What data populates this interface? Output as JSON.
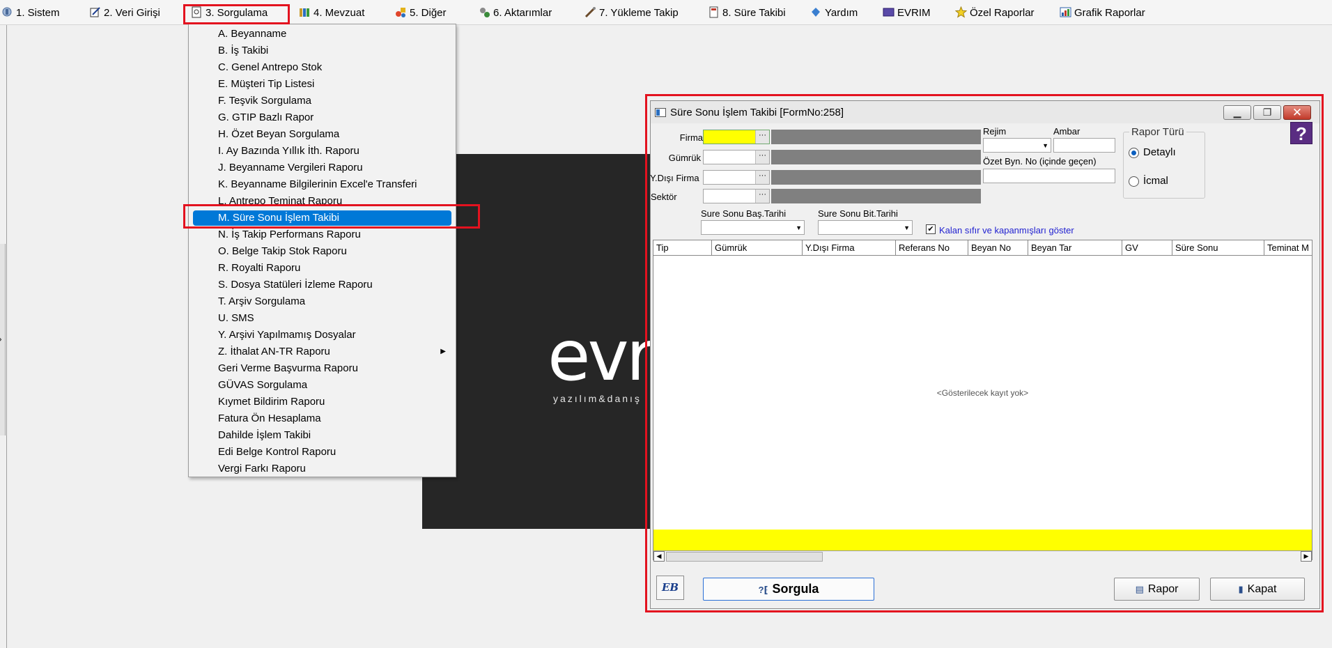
{
  "menubar": {
    "items": [
      {
        "label": "1.  Sistem",
        "icon": "wrench-icon"
      },
      {
        "label": "2.  Veri Girişi",
        "icon": "edit-icon"
      },
      {
        "label": "3.  Sorgulama",
        "icon": "report-icon"
      },
      {
        "label": "4.  Mevzuat",
        "icon": "books-icon"
      },
      {
        "label": "5.  Diğer",
        "icon": "shapes-icon"
      },
      {
        "label": "6.  Aktarımlar",
        "icon": "gears-icon"
      },
      {
        "label": "7.  Yükleme Takip",
        "icon": "tools-icon"
      },
      {
        "label": "8. Süre Takibi",
        "icon": "hourglass-icon"
      },
      {
        "label": "Yardım",
        "icon": "help-icon"
      },
      {
        "label": "EVRIM",
        "icon": "book-icon"
      },
      {
        "label": "Özel Raporlar",
        "icon": "star-icon"
      },
      {
        "label": "Grafik Raporlar",
        "icon": "chart-icon"
      }
    ]
  },
  "dropdown": {
    "items": [
      "A.  Beyanname",
      "B.  İş Takibi",
      "C.  Genel Antrepo Stok",
      "E.  Müşteri Tip Listesi",
      "F.  Teşvik Sorgulama",
      "G.  GTIP Bazlı Rapor",
      "H.  Özet Beyan Sorgulama",
      "I.   Ay Bazında Yıllık İth. Raporu",
      "J.   Beyanname Vergileri Raporu",
      "K.  Beyanname Bilgilerinin Excel'e Transferi",
      "L.  Antrepo Teminat Raporu",
      "M.  Süre Sonu İşlem Takibi",
      "N.  İş Takip Performans Raporu",
      "O.  Belge Takip Stok Raporu",
      "R.  Royalti Raporu",
      "S.   Dosya Statüleri İzleme Raporu",
      "T.   Arşiv Sorgulama",
      "U.  SMS",
      "Y.  Arşivi Yapılmamış Dosyalar",
      "Z.  İthalat AN-TR Raporu",
      "Geri Verme Başvurma Raporu",
      "GÜVAS Sorgulama",
      "Kıymet Bildirim Raporu",
      "Fatura Ön Hesaplama",
      "Dahilde İşlem Takibi",
      "Edi Belge Kontrol Raporu",
      "Vergi Farkı Raporu"
    ],
    "selected_index": 11,
    "submenu_index": 19
  },
  "splash": {
    "logo": "evri",
    "subtitle": "yazılım&danış"
  },
  "form": {
    "title": "Süre Sonu İşlem Takibi [FormNo:258]",
    "help_label": "?",
    "firma_label": "Firma",
    "gumruk_label": "Gümrük",
    "ydisi_label": "Y.Dışı Firma",
    "sektor_label": "Sektör",
    "rejim_label": "Rejim",
    "ambar_label": "Ambar",
    "ozet_label": "Özet Byn. No (içinde geçen)",
    "rapor_turu_title": "Rapor Türü",
    "radio_detayli": "Detaylı",
    "radio_icmal": "İcmal",
    "bas_tarihi_label": "Sure Sonu Baş.Tarihi",
    "bit_tarihi_label": "Sure Sonu Bit.Tarihi",
    "checkbox_label": "Kalan sıfır ve kapanmışları göster",
    "columns": [
      "Tip",
      "Gümrük",
      "Y.Dışı Firma",
      "Referans No",
      "Beyan No",
      "Beyan Tar",
      "GV",
      "Süre Sonu",
      "Teminat M"
    ],
    "empty_message": "<Gösterilecek kayıt yok>",
    "eb_label": "EB",
    "sorgula_label": "Sorgula",
    "rapor_label": "Rapor",
    "kapat_label": "Kapat"
  },
  "colors": {
    "highlight_red": "#e3121f",
    "selection_blue": "#0078d7",
    "field_yellow": "#ffff00",
    "help_purple": "#5a2d82"
  }
}
